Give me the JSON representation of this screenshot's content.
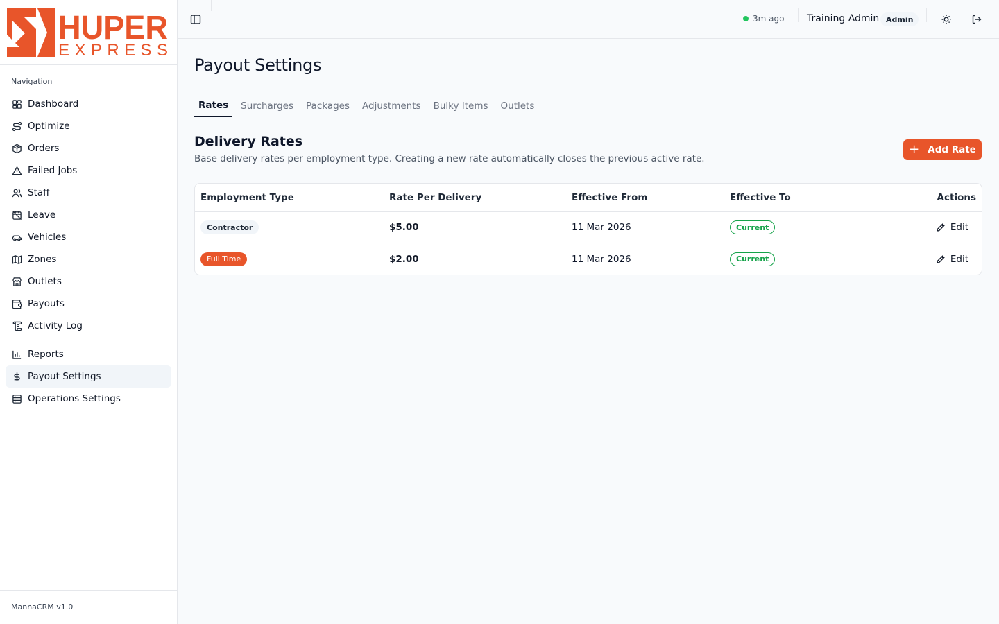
{
  "brand": {
    "logo_top": "HUPER",
    "logo_bottom": "EXPRESS",
    "accent": "#e8552a"
  },
  "sidebar": {
    "heading": "Navigation",
    "items": [
      {
        "label": "Dashboard",
        "icon": "dashboard-icon"
      },
      {
        "label": "Optimize",
        "icon": "route-icon"
      },
      {
        "label": "Orders",
        "icon": "package-icon"
      },
      {
        "label": "Failed Jobs",
        "icon": "warning-triangle-icon"
      },
      {
        "label": "Staff",
        "icon": "users-icon"
      },
      {
        "label": "Leave",
        "icon": "calendar-off-icon"
      },
      {
        "label": "Vehicles",
        "icon": "car-icon"
      },
      {
        "label": "Zones",
        "icon": "map-icon"
      },
      {
        "label": "Outlets",
        "icon": "store-icon"
      },
      {
        "label": "Payouts",
        "icon": "wallet-icon"
      },
      {
        "label": "Activity Log",
        "icon": "scroll-icon"
      }
    ],
    "settings_items": [
      {
        "label": "Reports",
        "icon": "bar-chart-icon"
      },
      {
        "label": "Payout Settings",
        "icon": "dollar-icon",
        "active": true
      },
      {
        "label": "Operations Settings",
        "icon": "server-icon"
      }
    ],
    "version": "MannaCRM v1.0"
  },
  "header": {
    "sync_status": "3m ago",
    "user_name": "Training Admin",
    "role": "Admin"
  },
  "page": {
    "title": "Payout Settings",
    "tabs": [
      "Rates",
      "Surcharges",
      "Packages",
      "Adjustments",
      "Bulky Items",
      "Outlets"
    ],
    "active_tab": "Rates",
    "section_title": "Delivery Rates",
    "section_desc": "Base delivery rates per employment type. Creating a new rate automatically closes the previous active rate.",
    "add_button": "Add Rate"
  },
  "table": {
    "columns": [
      "Employment Type",
      "Rate Per Delivery",
      "Effective From",
      "Effective To",
      "Actions"
    ],
    "rows": [
      {
        "type": "Contractor",
        "type_style": "neutral",
        "rate": "$5.00",
        "from": "11 Mar 2026",
        "to": "Current",
        "action": "Edit"
      },
      {
        "type": "Full Time",
        "type_style": "accent",
        "rate": "$2.00",
        "from": "11 Mar 2026",
        "to": "Current",
        "action": "Edit"
      }
    ]
  }
}
